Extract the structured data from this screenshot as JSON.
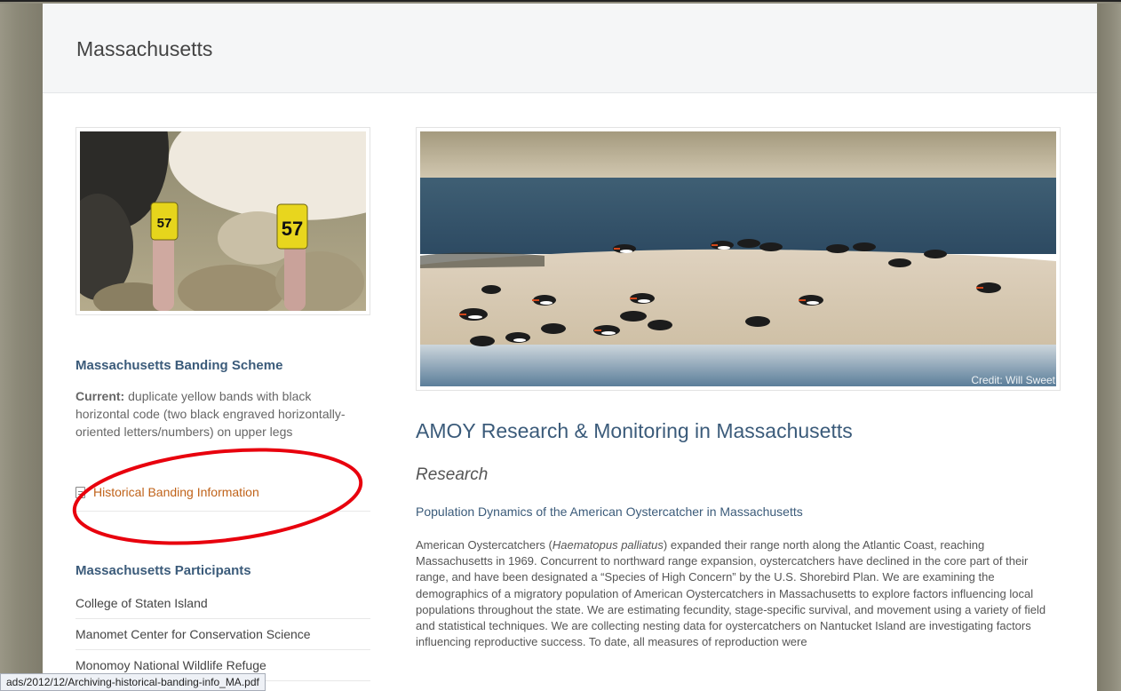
{
  "page": {
    "title": "Massachusetts"
  },
  "banding_scheme": {
    "heading": "Massachusetts Banding Scheme",
    "current_label": "Current:",
    "current_text": " duplicate yellow bands with black horizontal code (two black engraved horizontally-oriented letters/numbers) on upper legs",
    "historical_link": "Historical Banding Information",
    "band_code": "57"
  },
  "participants": {
    "heading": "Massachusetts Participants",
    "items": [
      "College of Staten Island",
      "Manomet Center for Conservation Science",
      "Monomoy National Wildlife Refuge"
    ]
  },
  "hero": {
    "credit": "Credit: Will Sweet"
  },
  "research": {
    "heading": "AMOY Research & Monitoring in Massachusetts",
    "subheading": "Research",
    "article_link": "Population Dynamics of the American Oystercatcher in Massachusetts",
    "body_before": "American Oystercatchers (",
    "body_italic": "Haematopus palliatus",
    "body_after": ") expanded their range north along the Atlantic Coast, reaching Massachusetts in 1969. Concurrent to northward range expansion, oystercatchers have declined in the core part of their range, and have been designated a “Species of High Concern” by the U.S. Shorebird Plan. We are examining the demographics of a migratory population of American Oystercatchers in Massachusetts to explore factors influencing local populations throughout the state. We are estimating fecundity, stage-specific survival, and movement using a variety of field and statistical techniques. We are collecting nesting data for oystercatchers on Nantucket Island are investigating factors influencing reproductive success. To date, all measures of reproduction were"
  },
  "status_bar": {
    "url": "ads/2012/12/Archiving-historical-banding-info_MA.pdf"
  },
  "colors": {
    "heading_blue": "#3b5b7a",
    "link_orange": "#c0631a",
    "annotation_red": "#e8000d"
  }
}
